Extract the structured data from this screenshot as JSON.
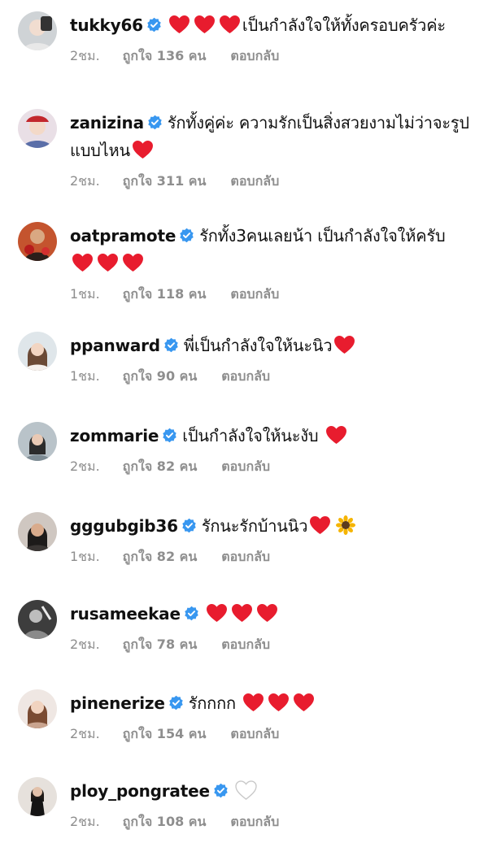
{
  "colors": {
    "accent_verified": "#3897f0",
    "heart_red": "#e81c2e",
    "meta_gray": "#8e8e8e",
    "text": "#111111"
  },
  "comments": [
    {
      "username": "tukky66",
      "verified": true,
      "text_before": "",
      "hearts_before": 3,
      "text": "เป็นกำลังใจให้ทั้งครอบครัวค่ะ",
      "hearts_after": 0,
      "extra_icon": "",
      "time": "2ชม.",
      "likes": "ถูกใจ 136 คน",
      "reply": "ตอบกลับ"
    },
    {
      "username": "zanizina",
      "verified": true,
      "text": "รักทั้งคู่ค่ะ ความรักเป็นสิ่งสวยงามไม่ว่าจะรูปแบบไหน",
      "hearts_after": 1,
      "extra_icon": "",
      "time": "2ชม.",
      "likes": "ถูกใจ 311 คน",
      "reply": "ตอบกลับ"
    },
    {
      "username": "oatpramote",
      "verified": true,
      "text": "รักทั้ง3คนเลยน้า เป็นกำลังใจให้ครับ",
      "hearts_after": 3,
      "extra_icon": "",
      "time": "1ชม.",
      "likes": "ถูกใจ 118 คน",
      "reply": "ตอบกลับ"
    },
    {
      "username": "ppanward",
      "verified": true,
      "text": "พี่เป็นกำลังใจให้นะนิว",
      "hearts_after": 1,
      "extra_icon": "",
      "time": "1ชม.",
      "likes": "ถูกใจ 90 คน",
      "reply": "ตอบกลับ"
    },
    {
      "username": "zommarie",
      "verified": true,
      "text": "เป็นกำลังใจให้นะงับ",
      "hearts_after": 1,
      "extra_icon": "",
      "time": "2ชม.",
      "likes": "ถูกใจ 82 คน",
      "reply": "ตอบกลับ"
    },
    {
      "username": "gggubgib36",
      "verified": true,
      "text": "รักนะรักบ้านนิว",
      "hearts_after": 1,
      "extra_icon": "sunflower-icon",
      "time": "1ชม.",
      "likes": "ถูกใจ 82 คน",
      "reply": "ตอบกลับ"
    },
    {
      "username": "rusameekae",
      "verified": true,
      "text": "",
      "hearts_after": 3,
      "extra_icon": "",
      "time": "2ชม.",
      "likes": "ถูกใจ 78 คน",
      "reply": "ตอบกลับ"
    },
    {
      "username": "pinenerize",
      "verified": true,
      "text": "รักกกก",
      "hearts_after": 3,
      "extra_icon": "",
      "time": "2ชม.",
      "likes": "ถูกใจ 154 คน",
      "reply": "ตอบกลับ"
    },
    {
      "username": "ploy_pongratee",
      "verified": true,
      "text": "",
      "hearts_after": 0,
      "white_hearts": 1,
      "extra_icon": "",
      "time": "2ชม.",
      "likes": "ถูกใจ 108 คน",
      "reply": "ตอบกลับ"
    }
  ]
}
